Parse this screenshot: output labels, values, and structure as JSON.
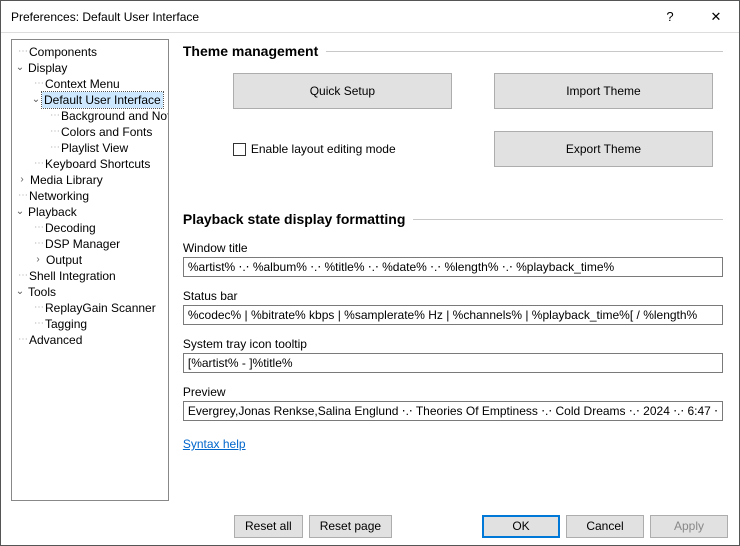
{
  "window": {
    "title": "Preferences: Default User Interface",
    "help_label": "?",
    "close_label": "✕"
  },
  "tree": {
    "components": "Components",
    "display": "Display",
    "context_menu": "Context Menu",
    "dui": "Default User Interface",
    "bg_notif": "Background and Notifications",
    "colors_fonts": "Colors and Fonts",
    "playlist_view": "Playlist View",
    "kb_shortcuts": "Keyboard Shortcuts",
    "media_library": "Media Library",
    "networking": "Networking",
    "playback": "Playback",
    "decoding": "Decoding",
    "dsp_manager": "DSP Manager",
    "output": "Output",
    "shell_integration": "Shell Integration",
    "tools": "Tools",
    "replaygain": "ReplayGain Scanner",
    "tagging": "Tagging",
    "advanced": "Advanced"
  },
  "theme": {
    "heading": "Theme management",
    "quick_setup": "Quick Setup",
    "import": "Import Theme",
    "export": "Export Theme",
    "enable_editing": "Enable layout editing mode"
  },
  "formatting": {
    "heading": "Playback state display formatting",
    "window_title_label": "Window title",
    "window_title_value": "%artist% ⋅.⋅ %album% ⋅.⋅ %title% ⋅.⋅ %date% ⋅.⋅ %length% ⋅.⋅ %playback_time%",
    "status_bar_label": "Status bar",
    "status_bar_value": "%codec% | %bitrate% kbps | %samplerate% Hz | %channels% | %playback_time%[ / %length%",
    "tray_label": "System tray icon tooltip",
    "tray_value": "[%artist% - ]%title%",
    "preview_label": "Preview",
    "preview_value": "Evergrey,Jonas Renkse,Salina Englund ⋅.⋅ Theories Of Emptiness ⋅.⋅ Cold Dreams ⋅.⋅ 2024 ⋅.⋅ 6:47 ⋅",
    "syntax_help": "Syntax help"
  },
  "footer": {
    "reset_all": "Reset all",
    "reset_page": "Reset page",
    "ok": "OK",
    "cancel": "Cancel",
    "apply": "Apply"
  }
}
